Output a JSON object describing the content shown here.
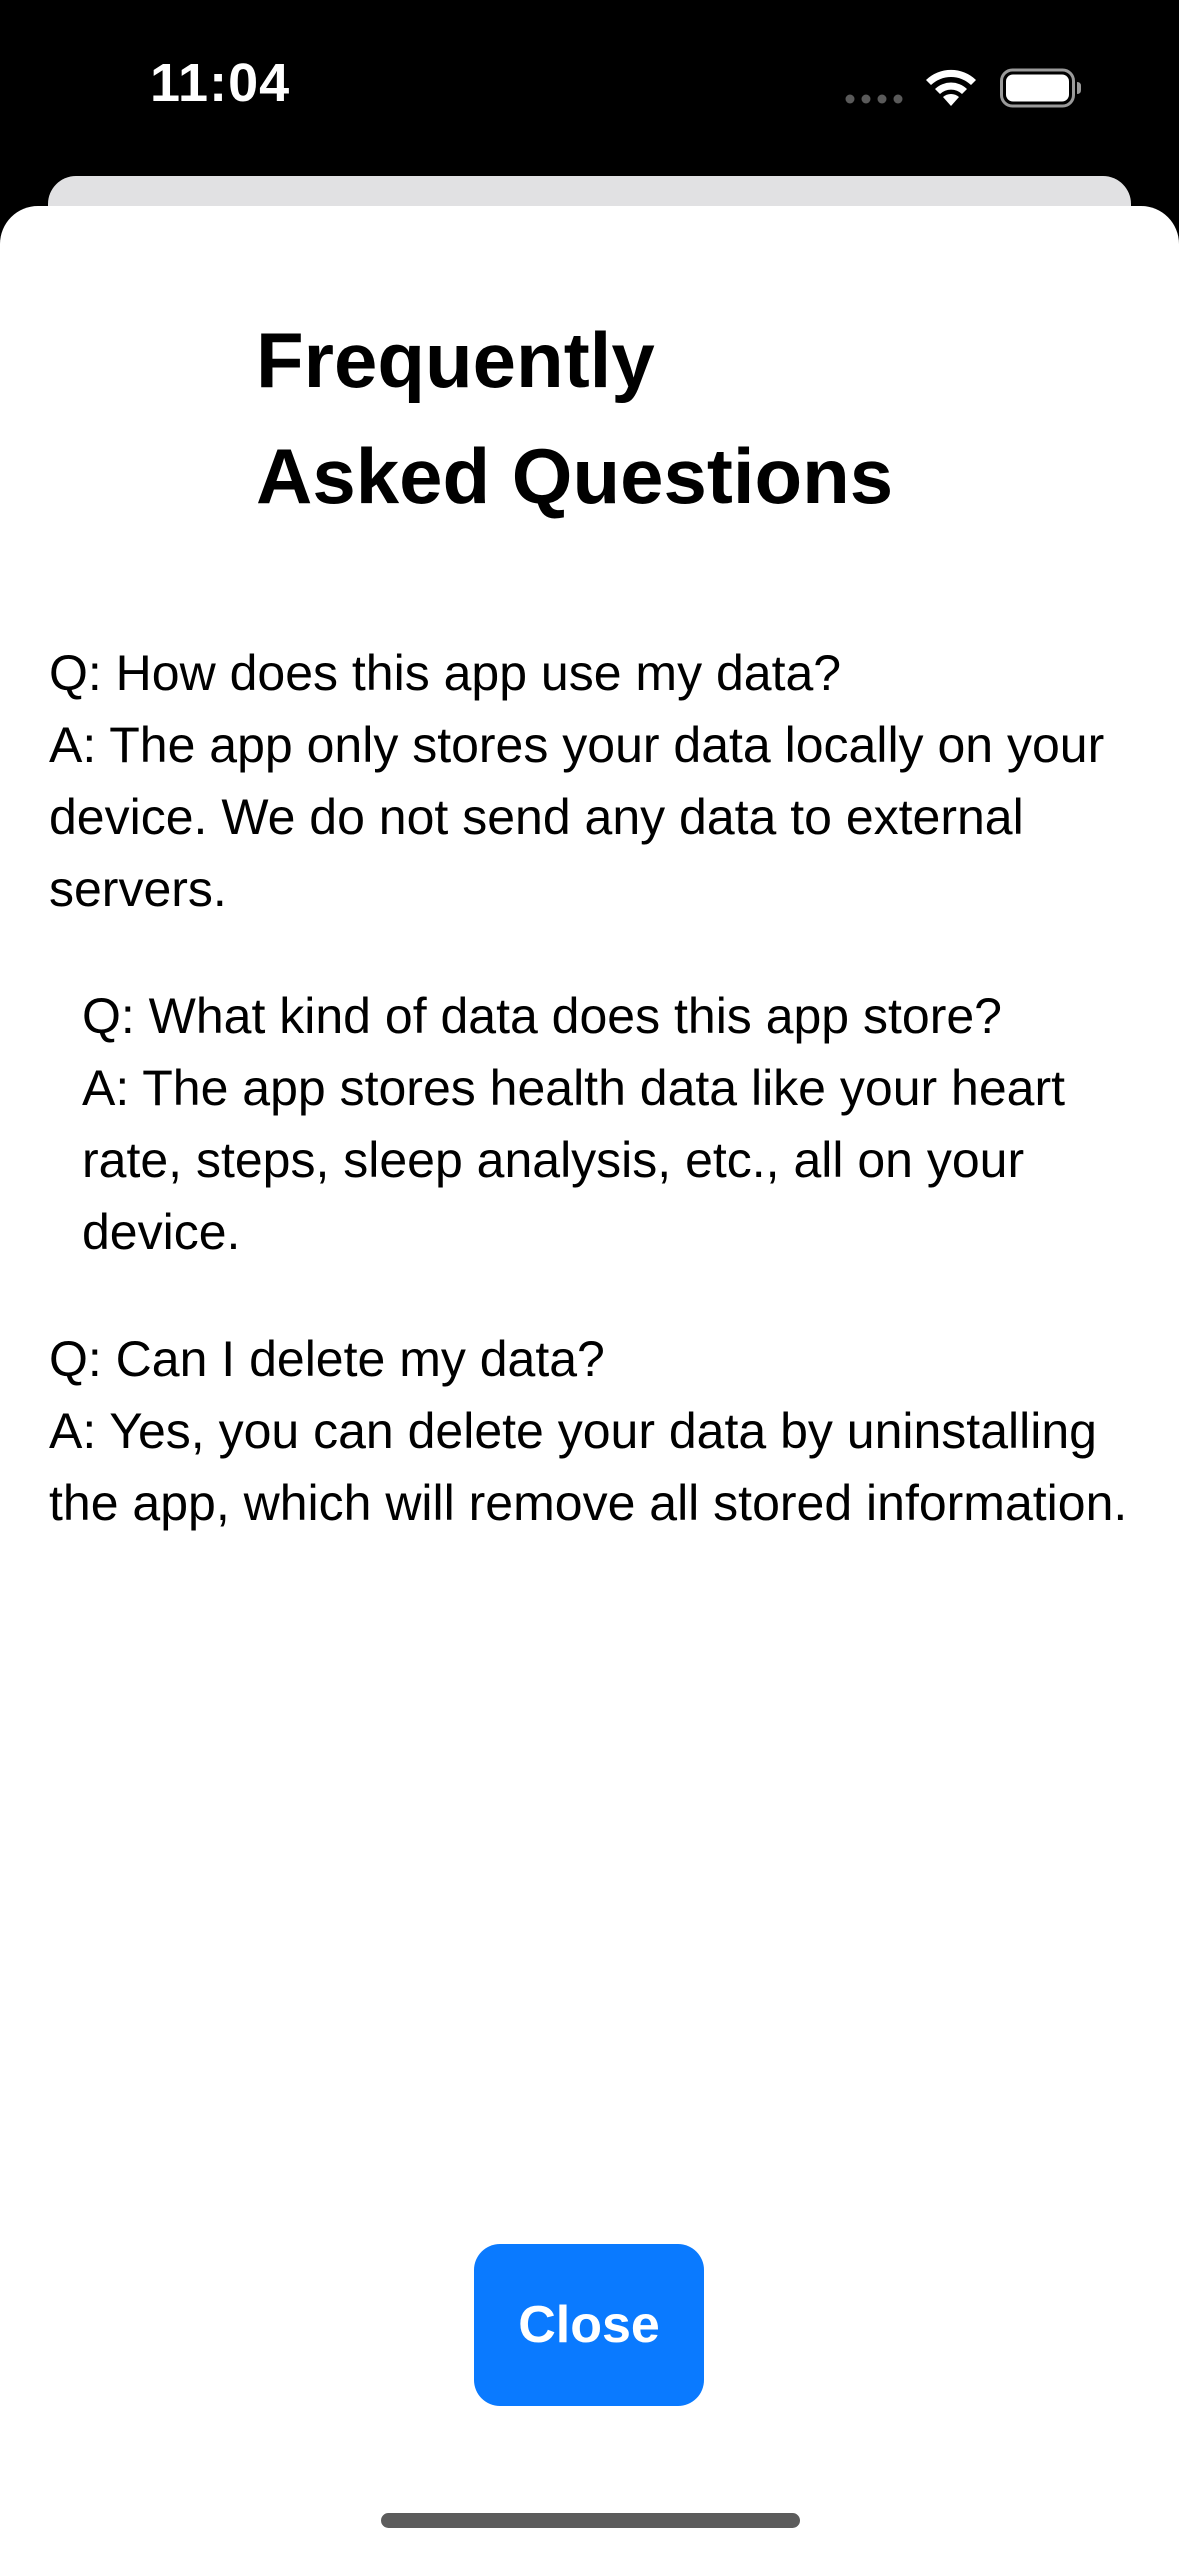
{
  "status_bar": {
    "time": "11:04",
    "icons": [
      "signal-dots-icon",
      "wifi-icon",
      "battery-icon"
    ]
  },
  "sheet": {
    "title_line1": "Frequently",
    "title_line2": "Asked Questions",
    "faqs": [
      {
        "question": "Q: How does this app use my data?",
        "answer": "A: The app only stores your data locally on your device. We do not send any data to external servers."
      },
      {
        "question": "Q: What kind of data does this app store?",
        "answer": "A: The app stores health data like your heart rate, steps, sleep analysis, etc., all on your device."
      },
      {
        "question": "Q: Can I delete my data?",
        "answer": "A: Yes, you can delete your data by uninstalling the app, which will remove all stored information."
      }
    ],
    "close_label": "Close"
  },
  "colors": {
    "accent": "#0a7aff",
    "background": "#ffffff",
    "status_bar": "#000000"
  }
}
